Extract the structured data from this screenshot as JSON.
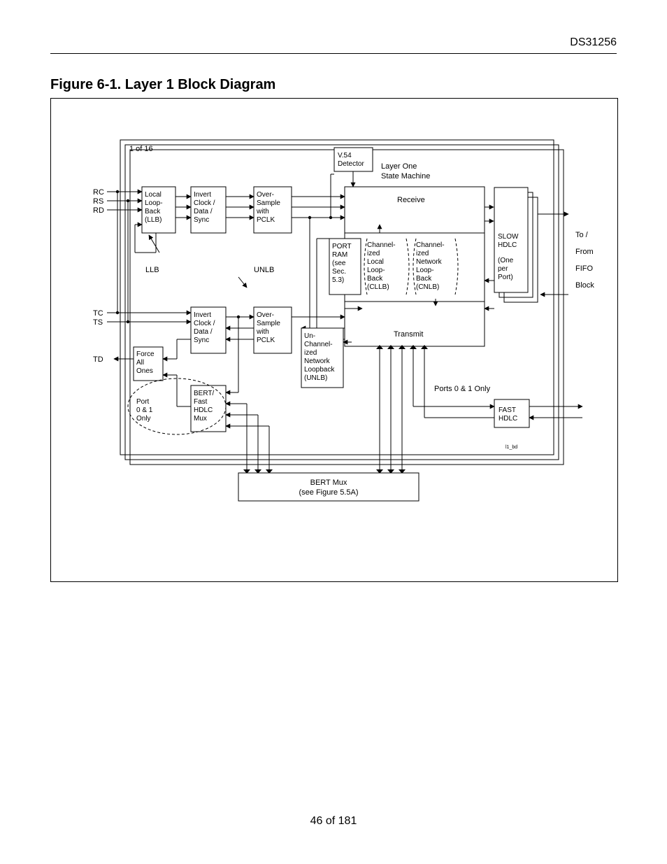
{
  "header": {
    "doc_id": "DS31256"
  },
  "title": "Figure 6-1. Layer 1 Block Diagram",
  "footer": {
    "page_of": "46 of 181"
  },
  "labels": {
    "oneof": "1 of 16",
    "rc": "RC",
    "rs": "RS",
    "rd": "RD",
    "tc": "TC",
    "ts": "TS",
    "td": "TD",
    "llb_box": "Local\nLoop-\nBack\n(LLB)",
    "invert_rx": "Invert\nClock /\nData /\nSync",
    "over_rx": "Over-\nSample\nwith\nPCLK",
    "invert_tx": "Invert\nClock /\nData /\nSync",
    "over_tx": "Over-\nSample\nwith\nPCLK",
    "force": "Force\nAll\nOnes",
    "bert_mux_box": "BERT/\nFast\nHDLC\nMux",
    "port01": "Port\n0 & 1\nOnly",
    "v54": "V.54\nDetector",
    "llb": "LLB",
    "unlb": "UNLB",
    "port_ram": "PORT\nRAM\n(see\nSec.\n5.3)",
    "cllb": "Channel-\nized\nLocal\nLoop-\nBack\n(CLLB)",
    "cnlb": "Channel-\nized\nNetwork\nLoop-\nBack\n(CNLB)",
    "unlb_box": "Un-\nChannel-\nized\nNetwork\nLoopback\n(UNLB)",
    "receive": "Receive",
    "transmit": "Transmit",
    "l1sm": "Layer One\nState Machine",
    "slow": "SLOW\nHDLC\n\n(One\nper\nPort)",
    "fast": "FAST\nHDLC",
    "p01only": "Ports 0 & 1 Only",
    "right": "To /\n\nFrom\n\nFIFO\n\nBlock",
    "bert_mux": "BERT Mux\n(see Figure 5.5A)",
    "tag": "l1_bd"
  }
}
